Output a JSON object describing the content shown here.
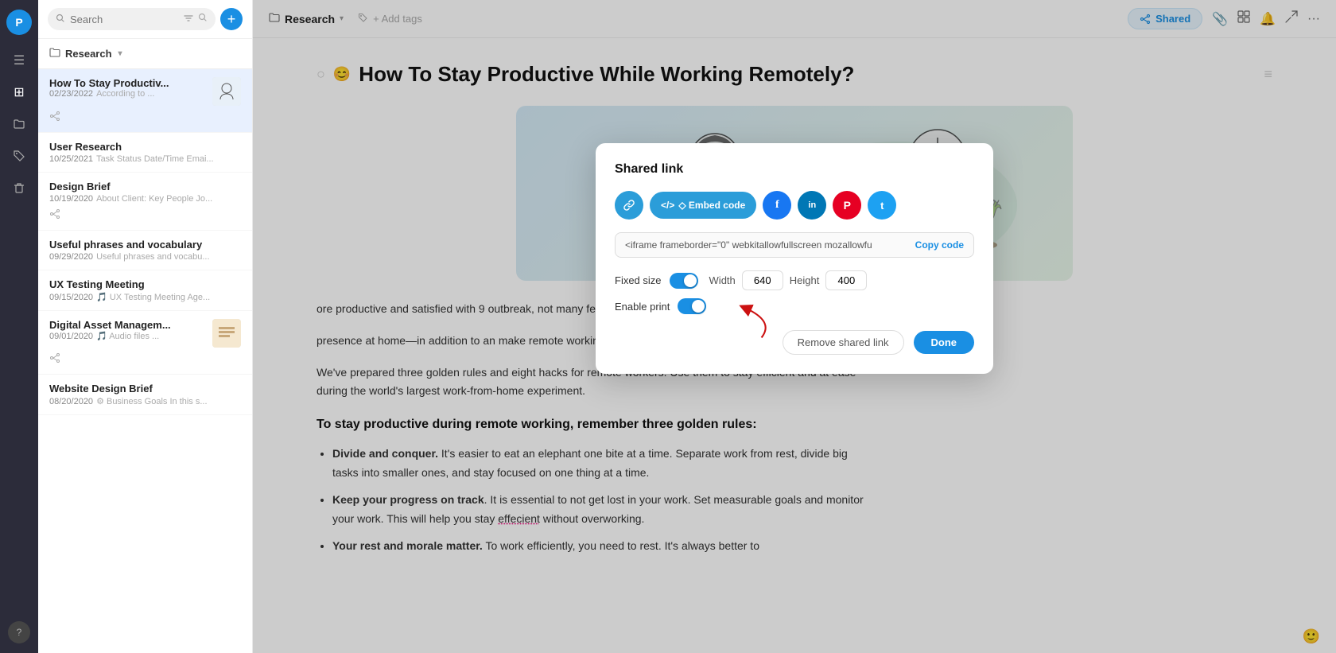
{
  "sidebar": {
    "avatar_letter": "P",
    "icons": [
      {
        "name": "home-icon",
        "symbol": "⊞",
        "active": false
      },
      {
        "name": "folder-icon",
        "symbol": "📁",
        "active": false
      },
      {
        "name": "tag-icon",
        "symbol": "🏷",
        "active": false
      },
      {
        "name": "trash-icon",
        "symbol": "🗑",
        "active": false
      }
    ],
    "help_label": "?"
  },
  "file_panel": {
    "search_placeholder": "Search",
    "folder_name": "Research",
    "files": [
      {
        "title": "How To Stay Productiv...",
        "date": "02/23/2022",
        "preview": "According to ...",
        "has_thumb": true,
        "has_share": true,
        "active": true
      },
      {
        "title": "User Research",
        "date": "10/25/2021",
        "preview": "Task Status Date/Time Emai...",
        "has_thumb": false,
        "has_share": false,
        "active": false
      },
      {
        "title": "Design Brief",
        "date": "10/19/2020",
        "preview": "About Client: Key People Jo...",
        "has_thumb": false,
        "has_share": true,
        "active": false
      },
      {
        "title": "Useful phrases and vocabulary",
        "date": "09/29/2020",
        "preview": "Useful phrases and vocabu...",
        "has_thumb": false,
        "has_share": false,
        "active": false
      },
      {
        "title": "UX Testing Meeting",
        "date": "09/15/2020",
        "preview": "🎵 UX Testing Meeting Age...",
        "has_thumb": false,
        "has_share": false,
        "active": false
      },
      {
        "title": "Digital Asset Managem...",
        "date": "09/01/2020",
        "preview": "🎵 Audio files ...",
        "has_thumb": true,
        "has_share": true,
        "active": false
      },
      {
        "title": "Website Design Brief",
        "date": "08/20/2020",
        "preview": "⚙ Business Goals In this s...",
        "has_thumb": false,
        "has_share": false,
        "active": false
      }
    ]
  },
  "topbar": {
    "folder_label": "Research",
    "add_tags_label": "+ Add tags",
    "shared_label": "Shared"
  },
  "document": {
    "title": "How To Stay Productive While Working Remotely?",
    "body_paragraphs": [
      "ore productive and satisfied with 9 outbreak, not many feel this way.",
      "presence at home—in addition to an make remote working challenging for you and your family members.",
      "We've prepared three golden rules and eight hacks for remote workers. Use them to stay efficient and at ease during the world's largest work-from-home experiment."
    ],
    "heading": "To stay productive during remote working, remember three golden rules:",
    "bullet_items": [
      {
        "bold": "Divide and conquer.",
        "text": " It's easier to eat an elephant one bite at a time. Separate work from rest, divide big tasks into smaller ones, and stay focused on one thing at a time."
      },
      {
        "bold": "Keep your progress on track",
        "text": ". It is essential to not get lost in your work. Set measurable goals and monitor your work. This will help you stay effecient without overworking."
      },
      {
        "bold": "Your rest and morale matter.",
        "text": " To work efficiently, you need to rest. It's always better to"
      }
    ]
  },
  "modal": {
    "title": "Shared link",
    "embed_code_value": "<iframe frameborder=\"0\" webkitallowfullscreen mozallowfu",
    "copy_code_label": "Copy code",
    "fixed_size_label": "Fixed size",
    "width_label": "Width",
    "width_value": "640",
    "height_label": "Height",
    "height_value": "400",
    "enable_print_label": "Enable print",
    "remove_shared_label": "Remove shared link",
    "done_label": "Done",
    "share_buttons": [
      {
        "name": "link-share-btn",
        "symbol": "🔗",
        "class": "share-btn-link"
      },
      {
        "name": "embed-share-btn",
        "label": "◇ Embed code",
        "class": "share-btn-embed"
      },
      {
        "name": "facebook-share-btn",
        "symbol": "f",
        "class": "share-btn-fb"
      },
      {
        "name": "linkedin-share-btn",
        "symbol": "in",
        "class": "share-btn-in"
      },
      {
        "name": "pinterest-share-btn",
        "symbol": "P",
        "class": "share-btn-pin"
      },
      {
        "name": "twitter-share-btn",
        "symbol": "𝕥",
        "class": "share-btn-tw"
      }
    ]
  }
}
